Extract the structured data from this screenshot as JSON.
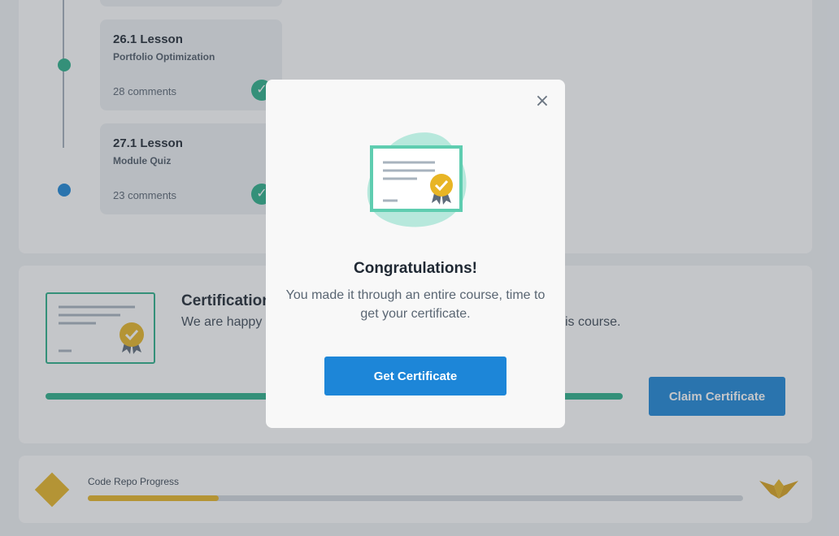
{
  "timeline": {
    "lessons": [
      {
        "title": "26.1 Lesson",
        "subtitle": "Portfolio Optimization",
        "comments": "28 comments",
        "status": "completed"
      },
      {
        "title": "27.1 Lesson",
        "subtitle": "Module Quiz",
        "comments": "23 comments",
        "status": "completed"
      }
    ],
    "check_glyph": "✓"
  },
  "certification": {
    "title": "Certification",
    "description_left": "We are happy",
    "description_right": "is course.",
    "progress": 1.0,
    "claim_label": "Claim Certificate"
  },
  "repo": {
    "label": "Code Repo Progress",
    "progress": 0.2
  },
  "modal": {
    "close_glyph": "×",
    "title": "Congratulations!",
    "text": "You made it through an entire course, time to get your certificate.",
    "button_label": "Get Certificate"
  },
  "colors": {
    "accent_blue": "#1d86d8",
    "success_green": "#2bb08a",
    "gold": "#e8b525",
    "mint": "#b7e8dc"
  },
  "icons": {
    "certificate": "certificate-icon",
    "check": "check-icon",
    "close": "close-icon",
    "repo": "diamond-icon",
    "logo": "wings-logo-icon"
  }
}
